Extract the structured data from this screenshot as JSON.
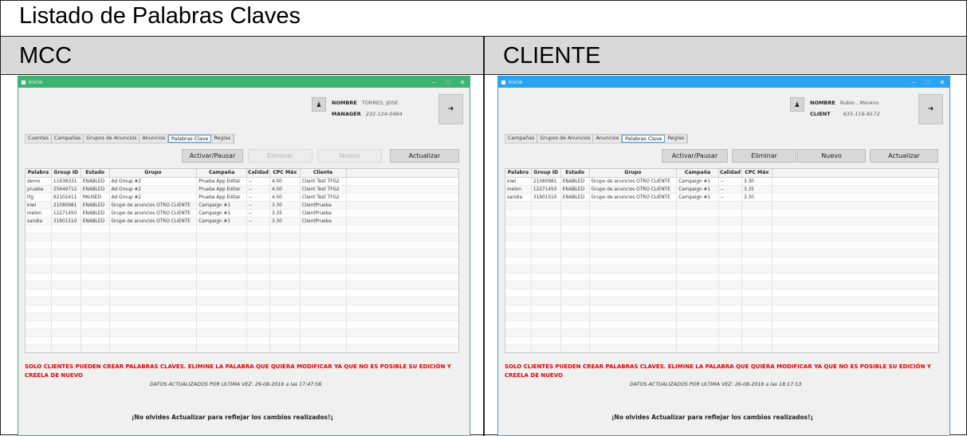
{
  "page": {
    "title": "Listado de Palabras Claves",
    "left_header": "MCC",
    "right_header": "CLIENTE"
  },
  "colors": {
    "mcc_titlebar": "#3cb371",
    "client_titlebar": "#2aa3f0",
    "warning": "#e00000"
  },
  "mcc": {
    "window_title": "Inicio",
    "user": {
      "name_label": "NOMBRE",
      "name_value": "TORRES, JOSE",
      "role_label": "MANAGER",
      "role_value": "232-124-0484",
      "icon": "user-icon"
    },
    "logout_icon": "logout-icon",
    "tabs": [
      "Cuentas",
      "Campañas",
      "Grupos de Anuncios",
      "Anuncios",
      "Palabras Clave",
      "Reglas"
    ],
    "active_tab": "Palabras Clave",
    "buttons": {
      "toggle": "Activar/Pausar",
      "delete": "Eliminar",
      "new": "Nuevo",
      "refresh": "Actualizar"
    },
    "columns": [
      "Palabra",
      "Group ID",
      "Estado",
      "Grupo",
      "Campaña",
      "Calidad",
      "CPC Máx",
      "Cliente"
    ],
    "rows": [
      [
        "demo",
        "11938331",
        "ENABLED",
        "Ad Group #2",
        "Prueba App Editar",
        "--",
        "4.00",
        "Client Test TFG2"
      ],
      [
        "prueba",
        "25649712",
        "ENABLED",
        "Ad Group #2",
        "Prueba App Editar",
        "--",
        "4.00",
        "Client Test TFG2"
      ],
      [
        "tfg",
        "92102411",
        "PAUSED",
        "Ad Group #2",
        "Prueba App Editar",
        "--",
        "4.00",
        "Client Test TFG2"
      ],
      [
        "kiwi",
        "21080981",
        "ENABLED",
        "Grupo de anuncios OTRO CLIENTE",
        "Campaign #1",
        "--",
        "3.30",
        "ClientPrueba"
      ],
      [
        "melon",
        "12271450",
        "ENABLED",
        "Grupo de anuncios OTRO CLIENTE",
        "Campaign #1",
        "--",
        "3.35",
        "ClientPrueba"
      ],
      [
        "sandia",
        "31901510",
        "ENABLED",
        "Grupo de anuncios OTRO CLIENTE",
        "Campaign #1",
        "--",
        "3.30",
        "ClientPrueba"
      ]
    ],
    "warning": "SOLO CLIENTES PUEDEN CREAR PALABRAS CLAVES. ELIMINE LA PALABRA QUE QUIERA MODIFICAR YA QUE NO ES POSIBLE SU EDICIÓN Y CREELA DE NUEVO",
    "updated": "DATOS ACTUALIZADOS POR ULTIMA VEZ: 29-08-2016 a las 17:47:56",
    "reminder": "¡No olvides Actualizar para reflejar los cambios realizados!¡"
  },
  "client": {
    "window_title": "Inicio",
    "user": {
      "name_label": "NOMBRE",
      "name_value": "Rubio , Moreno",
      "role_label": "CLIENT",
      "role_value": "635-116-9172",
      "icon": "user-icon"
    },
    "logout_icon": "logout-icon",
    "tabs": [
      "Campañas",
      "Grupos de Anuncios",
      "Anuncios",
      "Palabras Clave",
      "Reglas"
    ],
    "active_tab": "Palabras Clave",
    "buttons": {
      "toggle": "Activar/Pausar",
      "delete": "Eliminar",
      "new": "Nuevo",
      "refresh": "Actualizar"
    },
    "columns": [
      "Palabra",
      "Group ID",
      "Estado",
      "Grupo",
      "Campaña",
      "Calidad",
      "CPC Máx"
    ],
    "rows": [
      [
        "kiwi",
        "21080981",
        "ENABLED",
        "Grupo de anuncios OTRO CLIENTE",
        "Campaign #1",
        "--",
        "3.30"
      ],
      [
        "melon",
        "12271450",
        "ENABLED",
        "Grupo de anuncios OTRO CLIENTE",
        "Campaign #1",
        "--",
        "3.35"
      ],
      [
        "sandia",
        "31901510",
        "ENABLED",
        "Grupo de anuncios OTRO CLIENTE",
        "Campaign #1",
        "--",
        "3.30"
      ]
    ],
    "warning": "SOLO CLIENTES PUEDEN CREAR PALABRAS CLAVES. ELIMINE LA PALABRA QUE QUIERA MODIFICAR YA QUE NO ES POSIBLE SU EDICIÓN Y CREELA DE NUEVO",
    "updated": "DATOS ACTUALIZADOS POR ULTIMA VEZ: 26-08-2016 a las 18:17:13",
    "reminder": "¡No olvides Actualizar para reflejar los cambios realizados!¡"
  }
}
